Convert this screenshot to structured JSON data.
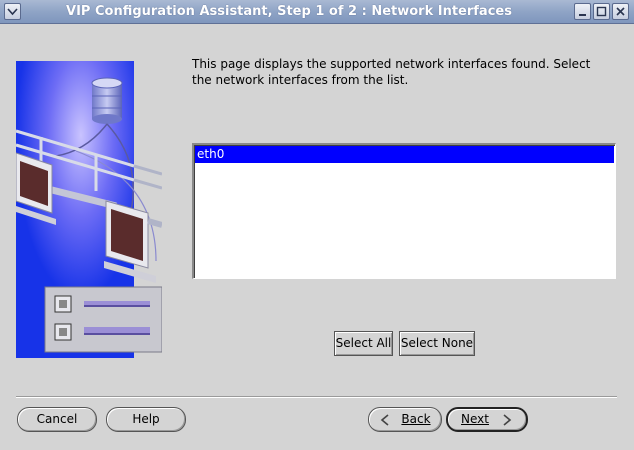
{
  "window": {
    "title": "VIP Configuration Assistant, Step 1 of 2 : Network Interfaces",
    "menu_icon": "chevron-down-icon",
    "controls": [
      "minimize-icon",
      "maximize-icon",
      "close-icon"
    ]
  },
  "main": {
    "description": "This page displays the supported network interfaces found. Select the network interfaces from the list.",
    "interfaces": [
      {
        "name": "eth0",
        "selected": true
      }
    ],
    "select_all_label": "Select All",
    "select_none_label": "Select None"
  },
  "footer": {
    "cancel_label": "Cancel",
    "help_label": "Help",
    "back_label": "Back",
    "next_label": "Next"
  },
  "colors": {
    "selection": "#0000ff",
    "titlebar": "#8fa4c6",
    "background": "#d4d4d4",
    "art_blue": "#1733e8"
  }
}
